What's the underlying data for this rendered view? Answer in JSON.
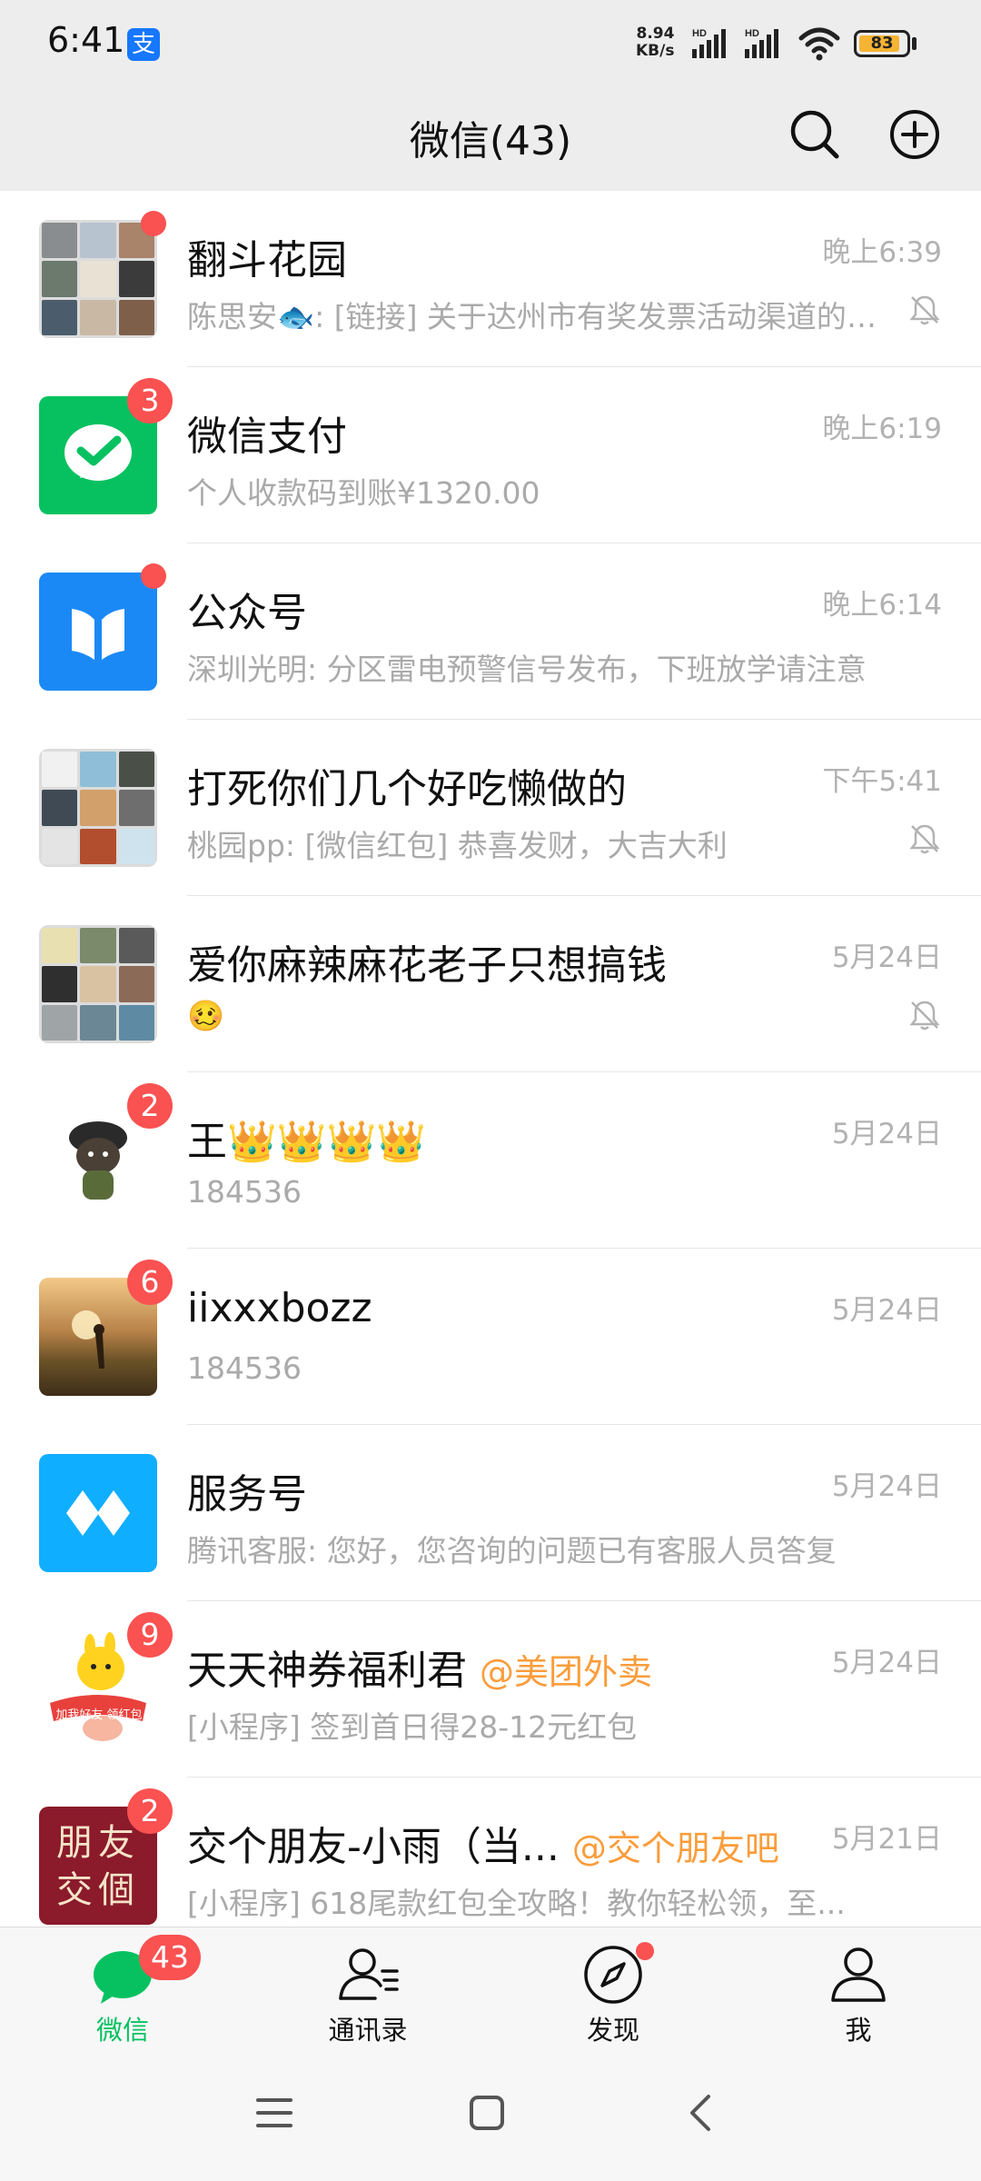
{
  "status_bar": {
    "time": "6:41",
    "app_icon_label": "支",
    "speed_value": "8.94",
    "speed_unit": "KB/s",
    "hd1": "HD",
    "hd2": "HD",
    "battery": "83"
  },
  "header": {
    "title": "微信(43)",
    "search_icon": "search-icon",
    "add_icon": "plus-circle-icon"
  },
  "chats": [
    {
      "name": "翻斗花园",
      "preview": "陈思安🐟: [链接] 关于达州市有奖发票活动渠道的公告",
      "time": "晚上6:39",
      "muted": true,
      "dot": true
    },
    {
      "name": "微信支付",
      "preview": "个人收款码到账¥1320.00",
      "time": "晚上6:19",
      "badge": "3"
    },
    {
      "name": "公众号",
      "preview": "深圳光明: 分区雷电预警信号发布，下班放学请注意",
      "time": "晚上6:14",
      "dot": true
    },
    {
      "name": "打死你们几个好吃懒做的",
      "preview": "桃园pp: [微信红包] 恭喜发财，大吉大利",
      "time": "下午5:41",
      "muted": true
    },
    {
      "name": "爱你麻辣麻花老子只想搞钱",
      "preview": "🥴",
      "time": "5月24日",
      "muted": true
    },
    {
      "name": "王👑👑👑👑",
      "preview": "184536",
      "time": "5月24日",
      "badge": "2"
    },
    {
      "name": "iixxxbozz",
      "preview": "184536",
      "time": "5月24日",
      "badge": "6"
    },
    {
      "name": "服务号",
      "preview": "腾讯客服: 您好，您咨询的问题已有客服人员答复",
      "time": "5月24日"
    },
    {
      "name": "天天神券福利君",
      "mention": "@美团外卖",
      "preview": "[小程序] 签到首日得28-12元红包",
      "time": "5月24日",
      "badge": "9",
      "avatar_text": "加我好友 领红包"
    },
    {
      "name": "交个朋友-小雨（当...",
      "mention": "@交个朋友吧",
      "preview": "[小程序] 618尾款红包全攻略！教你轻松领，至...",
      "time": "5月21日",
      "badge": "2",
      "avatar_text": "朋友 交個"
    }
  ],
  "tabs": [
    {
      "label": "微信",
      "icon": "chat-bubble-icon",
      "badge": "43",
      "active": true
    },
    {
      "label": "通讯录",
      "icon": "contacts-icon"
    },
    {
      "label": "发现",
      "icon": "compass-icon",
      "dot": true
    },
    {
      "label": "我",
      "icon": "person-icon"
    }
  ],
  "colors": {
    "accent": "#07c160",
    "badge": "#fa5151",
    "header_bg": "#ededed",
    "mention": "#fa9d3b"
  }
}
